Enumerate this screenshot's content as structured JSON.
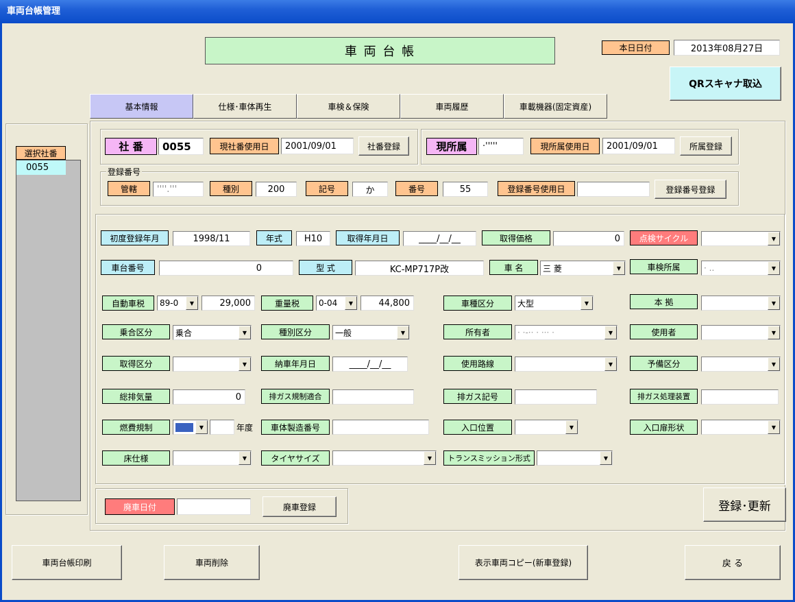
{
  "window": {
    "title": "車両台帳管理"
  },
  "header": {
    "title": "車 両 台 帳",
    "date_label": "本日日付",
    "date_value": "2013年08月27日",
    "qr_button": "QRスキャナ取込"
  },
  "tabs": [
    "基本情報",
    "仕様･車体再生",
    "車検＆保険",
    "車両履歴",
    "車載機器(固定資産)"
  ],
  "sidebar": {
    "label": "選択社番",
    "items": [
      "0055"
    ]
  },
  "company": {
    "num_label": "社 番",
    "num_value": "0055",
    "use_date_label": "現社番使用日",
    "use_date_value": "2001/09/01",
    "register_button": "社番登録"
  },
  "affiliation": {
    "label": "現所属",
    "value": "·'''''",
    "use_date_label": "現所属使用日",
    "use_date_value": "2001/09/01",
    "register_button": "所属登録"
  },
  "registration": {
    "group_label": "登録番号",
    "jurisdiction_label": "管轄",
    "jurisdiction_value": "''''.'''",
    "type_label": "種別",
    "type_value": "200",
    "symbol_label": "記号",
    "symbol_value": "か",
    "number_label": "番号",
    "number_value": "55",
    "use_date_label": "登録番号使用日",
    "use_date_value": "",
    "register_button": "登録番号登録"
  },
  "details": {
    "first_reg_label": "初度登録年月",
    "first_reg_value": "1998/11",
    "model_year_label": "年式",
    "model_year_value": "H10",
    "acq_date_label": "取得年月日",
    "acq_date_value": "____/__/__",
    "acq_price_label": "取得価格",
    "acq_price_value": "0",
    "inspection_cycle_label": "点検サイクル",
    "inspection_cycle_value": "",
    "chassis_label": "車台番号",
    "chassis_value": "0",
    "model_label": "型 式",
    "model_value": "KC-MP717P改",
    "car_name_label": "車 名",
    "car_name_value": "三 菱",
    "inspection_office_label": "車検所属",
    "inspection_office_value": "· ..",
    "auto_tax_label": "自動車税",
    "auto_tax_code": "89-0",
    "auto_tax_value": "29,000",
    "weight_tax_label": "重量税",
    "weight_tax_code": "0-04",
    "weight_tax_value": "44,800",
    "vehicle_class_label": "車種区分",
    "vehicle_class_value": "大型",
    "base_label": "本 拠",
    "base_value": "",
    "ride_class_label": "乗合区分",
    "ride_class_value": "乗合",
    "type_class_label": "種別区分",
    "type_class_value": "一般",
    "owner_label": "所有者",
    "owner_value": "· ·-·· · ··· ·",
    "user_label": "使用者",
    "user_value": "",
    "acq_class_label": "取得区分",
    "acq_class_value": "",
    "delivery_label": "納車年月日",
    "delivery_value": "____/__/__",
    "route_label": "使用路線",
    "route_value": "",
    "reserve_label": "予備区分",
    "reserve_value": "",
    "displacement_label": "総排気量",
    "displacement_value": "0",
    "emission_reg_label": "排ガス規制適合",
    "emission_reg_value": "",
    "emission_sym_label": "排ガス記号",
    "emission_sym_value": "",
    "emission_device_label": "排ガス処理装置",
    "emission_device_value": "",
    "fuel_label": "燃費規制",
    "fuel_year_unit": "年度",
    "body_serial_label": "車体製造番号",
    "body_serial_value": "",
    "entrance_pos_label": "入口位置",
    "entrance_pos_value": "",
    "door_shape_label": "入口扉形状",
    "door_shape_value": "",
    "floor_label": "床仕様",
    "floor_value": "",
    "tire_label": "タイヤサイズ",
    "tire_value": "",
    "trans_label": "トランスミッション形式",
    "trans_value": ""
  },
  "scrap": {
    "label": "廃車日付",
    "value": "",
    "button": "廃車登録"
  },
  "actions": {
    "update": "登録･更新",
    "print": "車両台帳印刷",
    "delete": "車両削除",
    "copy": "表示車両コピー(新車登録)",
    "back": "戻 る"
  },
  "colors": {
    "title_bar": "#1f5fd6",
    "label_cyan": "#bdeef7",
    "label_green": "#c8f5c8",
    "label_orange": "#ffc48f",
    "label_pink": "#f5b6f5",
    "label_red": "#ff7c7c",
    "active_tab": "#c7c7f5",
    "qr_button": "#c8f5f7"
  }
}
